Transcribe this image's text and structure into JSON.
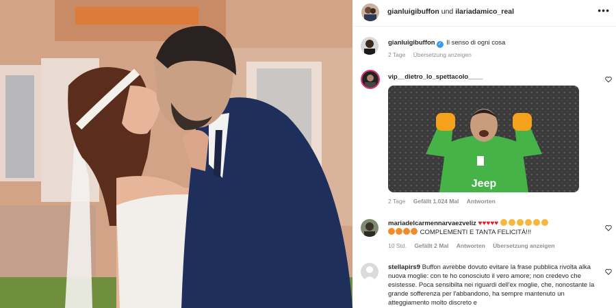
{
  "header": {
    "user1": "gianluigibuffon",
    "joiner": "und",
    "user2": "ilariadamico_real",
    "more_icon": "more-horizontal-icon"
  },
  "caption": {
    "username": "gianluigibuffon",
    "verified": true,
    "text": "Il senso di ogni cosa",
    "time": "2 Tage",
    "translate": "Übersetzung anzeigen"
  },
  "comments": [
    {
      "username": "vip__dietro_lo_spettacolo____",
      "media": "gif-goalkeeper-celebrating",
      "gif_logo": "Jeep",
      "time": "2 Tage",
      "likes": "Gefällt 1.024 Mal",
      "reply": "Antworten"
    },
    {
      "username": "mariadelcarmennarvaezveliz",
      "text": "COMPLEMENTI E TANTA FELICITÀ!!!",
      "time": "10 Std.",
      "likes": "Gefällt 2 Mal",
      "reply": "Antworten",
      "translate": "Übersetzung anzeigen"
    },
    {
      "username": "stellapirs9",
      "text": "Buffon avrebbe dovuto evitare la frase pubblica rivolta alka nuova moglie: con te ho conosciuto il vero amore; non credevo che esistesse. Poca sensibilta nei riguardi dell'ex moglie, che, nonostante la grande sofferenza per l'abbandono, ha sempre mantenuto un atteggiamento molto discreto e"
    }
  ],
  "colors": {
    "link": "#3897f0",
    "muted": "#8e8e8e",
    "heart": "#ed1c24",
    "text": "#262626"
  }
}
